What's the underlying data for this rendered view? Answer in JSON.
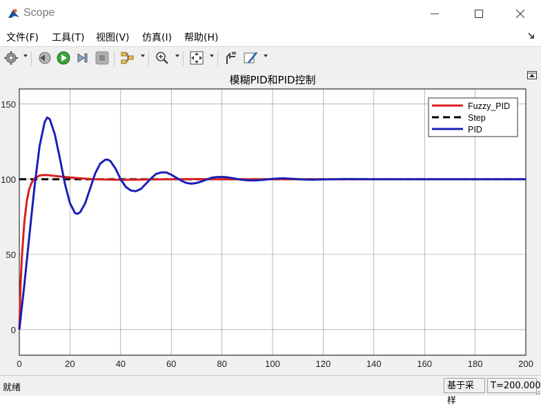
{
  "window": {
    "title": "Scope"
  },
  "menu": [
    {
      "label": "文件(F)"
    },
    {
      "label": "工具(T)"
    },
    {
      "label": "视图(V)"
    },
    {
      "label": "仿真(I)"
    },
    {
      "label": "帮助(H)"
    }
  ],
  "toolbar": {
    "icons": [
      "gear-icon",
      "back-step-icon",
      "run-icon",
      "step-forward-icon",
      "stop-icon",
      "signal-select-icon",
      "zoom-in-icon",
      "fit-to-view-icon",
      "cursor-measure-icon",
      "style-edit-icon"
    ]
  },
  "status": {
    "left": "就绪",
    "mode": "基于采样",
    "time": "T=200.000"
  },
  "colors": {
    "fuzzy": "#d91e1e",
    "step": "#000000",
    "pid": "#1a1fb3",
    "plot_bg": "#ffffff",
    "frame_bg": "#f0f0f0"
  },
  "chart_data": {
    "type": "line",
    "title": "模糊PID和PID控制",
    "xlabel": "",
    "ylabel": "",
    "xlim": [
      0,
      200
    ],
    "ylim": [
      -17,
      160
    ],
    "xticks": [
      0,
      20,
      40,
      60,
      80,
      100,
      120,
      140,
      160,
      180,
      200
    ],
    "yticks": [
      0,
      50,
      100,
      150
    ],
    "grid": true,
    "legend_position": "top-right",
    "series": [
      {
        "name": "Fuzzy_PID",
        "style": "solid",
        "x": [
          0,
          0.5,
          1,
          2,
          3,
          4,
          5,
          6,
          8,
          10,
          12,
          15,
          20,
          25,
          30,
          40,
          50,
          60,
          70,
          80,
          90,
          100,
          120,
          150,
          200
        ],
        "y": [
          0,
          30,
          48,
          72,
          86,
          94,
          98,
          100.5,
          102.5,
          102.8,
          102.6,
          102,
          101.2,
          100.5,
          100,
          99.6,
          99.8,
          100,
          100.1,
          100,
          100,
          100,
          100,
          100,
          100
        ]
      },
      {
        "name": "Step",
        "style": "dashed",
        "x": [
          0,
          200
        ],
        "y": [
          100,
          100
        ]
      },
      {
        "name": "PID",
        "style": "solid",
        "x": [
          0,
          2,
          4,
          6,
          8,
          10,
          11,
          12,
          14,
          16,
          18,
          20,
          22,
          23,
          24,
          26,
          28,
          30,
          32,
          34,
          35,
          36,
          38,
          40,
          42,
          44,
          46,
          48,
          50,
          52,
          54,
          56,
          58,
          60,
          62,
          64,
          66,
          68,
          70,
          72,
          74,
          76,
          78,
          81,
          84,
          87,
          90,
          93,
          96,
          100,
          104,
          108,
          112,
          116,
          120,
          130,
          140,
          160,
          200
        ],
        "y": [
          0,
          30,
          63,
          95,
          122,
          138,
          141,
          140,
          130,
          114,
          97,
          84,
          77.5,
          77,
          78,
          84,
          94,
          104,
          110.5,
          113,
          113,
          112,
          107,
          100,
          95,
          92.5,
          92,
          93.5,
          97,
          100.5,
          103.5,
          104.5,
          104.5,
          103,
          101,
          99,
          97.5,
          97,
          97.5,
          98.5,
          99.8,
          101,
          101.5,
          101.5,
          100.8,
          99.8,
          99.3,
          99.2,
          99.5,
          100.3,
          100.6,
          100.3,
          99.8,
          99.7,
          99.9,
          100.1,
          100,
          100,
          100
        ]
      }
    ]
  }
}
